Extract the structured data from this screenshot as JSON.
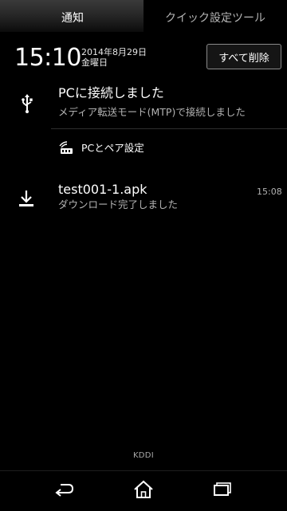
{
  "tabs": {
    "notifications": "通知",
    "quick_settings": "クイック設定ツール"
  },
  "header": {
    "time": "15:10",
    "date": "2014年8月29日",
    "day": "金曜日",
    "clear_all": "すべて削除"
  },
  "notifications": [
    {
      "icon": "usb-icon",
      "title": "PCに接続しました",
      "subtitle": "メディア転送モード(MTP)で接続しました",
      "action": {
        "icon": "pc-pairing-icon",
        "label": "PCとペア設定"
      }
    },
    {
      "icon": "download-complete-icon",
      "title": "test001-1.apk",
      "subtitle": "ダウンロード完了しました",
      "time": "15:08"
    }
  ],
  "carrier": "KDDI",
  "nav": {
    "back": "back-icon",
    "home": "home-icon",
    "recent": "recent-apps-icon"
  }
}
